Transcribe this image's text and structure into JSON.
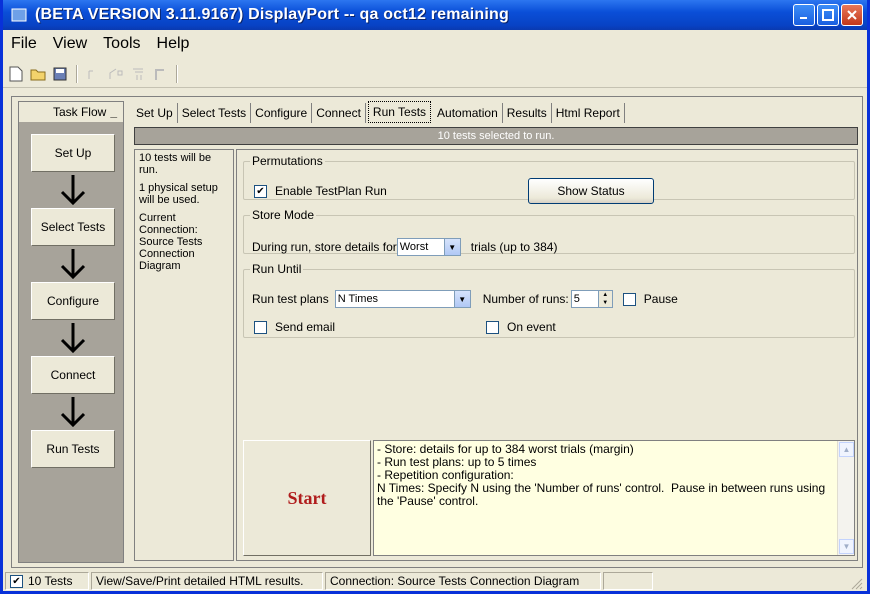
{
  "window": {
    "title": "(BETA VERSION 3.11.9167) DisplayPort -- qa oct12 remaining"
  },
  "menu": [
    "File",
    "View",
    "Tools",
    "Help"
  ],
  "toolbar_icons": [
    "new-file-icon",
    "open-folder-icon",
    "save-icon",
    "tool-4-icon",
    "tool-5-icon",
    "tool-6-icon",
    "tool-7-icon"
  ],
  "taskflow": {
    "title": "Task Flow",
    "steps": [
      "Set Up",
      "Select Tests",
      "Configure",
      "Connect",
      "Run Tests"
    ]
  },
  "tabs": [
    "Set Up",
    "Select Tests",
    "Configure",
    "Connect",
    "Run Tests",
    "Automation",
    "Results",
    "Html Report"
  ],
  "active_tab": "Run Tests",
  "selection_banner": "10 tests selected to run.",
  "info": {
    "line1": "10 tests will be run.",
    "line2": "1 physical setup will be used.",
    "line3": "Current Connection: Source Tests Connection Diagram"
  },
  "permutations": {
    "legend": "Permutations",
    "enable_label": "Enable TestPlan Run",
    "enable_checked": true,
    "show_status_label": "Show Status"
  },
  "store_mode": {
    "legend": "Store Mode",
    "prefix": "During run, store details for",
    "selected": "Worst",
    "suffix": "trials (up to 384)"
  },
  "run_until": {
    "legend": "Run Until",
    "run_plans_label": "Run test plans",
    "run_plans_selected": "N Times",
    "num_runs_label": "Number of runs:",
    "num_runs_value": "5",
    "pause_label": "Pause",
    "send_email_label": "Send email",
    "on_event_label": "On event"
  },
  "start_label": "Start",
  "notes": [
    "- Store: details for up to 384 worst trials (margin)",
    "- Run test plans: up to 5 times",
    "- Repetition configuration:",
    "N Times: Specify N using the 'Number of runs' control.  Pause in between runs using the 'Pause' control."
  ],
  "status": {
    "tests": "10 Tests",
    "hint": "View/Save/Print detailed HTML results.",
    "connection": "Connection: Source Tests Connection Diagram"
  },
  "colors": {
    "titlebar": "#0a4fd8",
    "start_text": "#b01c1c",
    "notes_bg": "#ffffe1"
  }
}
